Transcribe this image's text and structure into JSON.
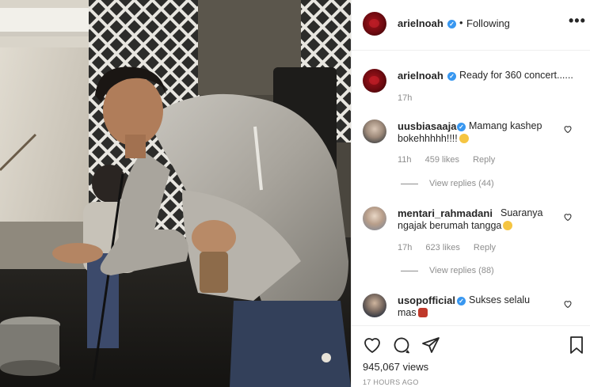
{
  "header": {
    "username": "arielnoah",
    "separator": "•",
    "follow_status": "Following",
    "more_label": "•••"
  },
  "caption": {
    "username": "arielnoah",
    "text": "Ready for 360 concert......",
    "time": "17h"
  },
  "comments": [
    {
      "username": "uusbiasaaja",
      "verified": true,
      "text_line1": "Mamang kashep",
      "text_line2": "bokehhhhh!!!!",
      "emoji": "screaming-face-emoji",
      "time": "11h",
      "likes": "459 likes",
      "reply": "Reply",
      "view_replies": "View replies (44)"
    },
    {
      "username": "mentari_rahmadani",
      "verified": false,
      "text_line1": "Suaranya",
      "text_line2": "ngajak berumah tangga",
      "emoji": "grinning-face-emoji",
      "time": "17h",
      "likes": "623 likes",
      "reply": "Reply",
      "view_replies": "View replies (88)"
    },
    {
      "username": "usopofficial",
      "verified": true,
      "text_line1": "Sukses selalu",
      "text_line2": "mas",
      "emoji": "praying-hands-emoji"
    }
  ],
  "actions": {
    "like_icon": "heart-icon",
    "comment_icon": "comment-icon",
    "share_icon": "send-icon",
    "save_icon": "bookmark-icon",
    "views": "945,067 views",
    "posted_ago": "17 HOURS AGO"
  },
  "colors": {
    "verified_badge": "#3897f0",
    "meta_text": "#8e8e8e",
    "primary_text": "#262626",
    "border": "#efefef"
  }
}
